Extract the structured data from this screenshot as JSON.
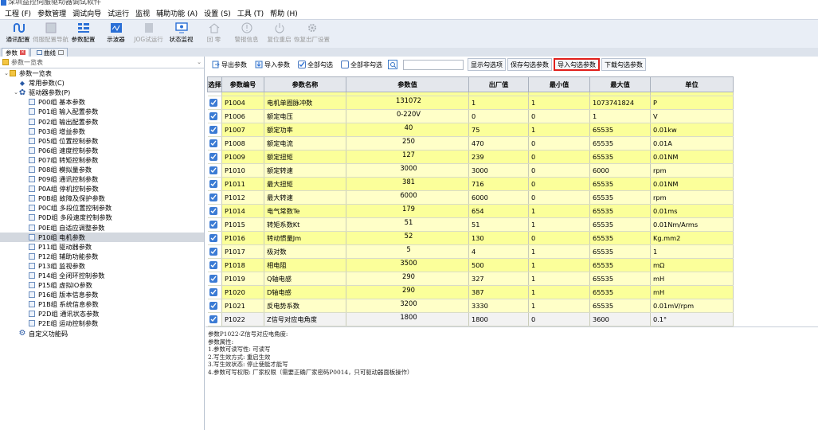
{
  "window": {
    "title": "深圳益控伺服驱动器调试软件"
  },
  "menu": [
    "工程 (F)",
    "参数管理",
    "调试向导",
    "试运行",
    "监视",
    "辅助功能 (A)",
    "设置 (S)",
    "工具 (T)",
    "帮助 (H)"
  ],
  "toolbar": [
    {
      "label": "通讯配置",
      "icon": "link-icon",
      "enabled": true
    },
    {
      "label": "伺服配置导航",
      "icon": "grid-icon",
      "enabled": false
    },
    {
      "label": "参数配置",
      "icon": "param-icon",
      "enabled": true
    },
    {
      "label": "示波器",
      "icon": "scope-icon",
      "enabled": true
    },
    {
      "label": "JOG试运行",
      "icon": "jog-icon",
      "enabled": false
    },
    {
      "label": "状态监视",
      "icon": "monitor-icon",
      "enabled": true
    },
    {
      "label": "回 零",
      "icon": "home-icon",
      "enabled": false
    },
    {
      "label": "警报信息",
      "icon": "alert-icon",
      "enabled": false
    },
    {
      "label": "复位重启",
      "icon": "power-icon",
      "enabled": false
    },
    {
      "label": "恢复出厂设置",
      "icon": "gear-icon",
      "enabled": false
    }
  ],
  "tabs": [
    {
      "label": "参数"
    },
    {
      "label": "曲线"
    }
  ],
  "left_panel": {
    "header": "参数一览表",
    "tree": [
      {
        "label": "参数一览表",
        "level": 0,
        "chev": "⌄",
        "icon": "folder-icon"
      },
      {
        "label": "常用参数(C)",
        "level": 1,
        "chev": "",
        "icon": "diamond-icon"
      },
      {
        "label": "驱动器参数(P)",
        "level": 1,
        "chev": "⌄",
        "icon": "gear-icon"
      },
      {
        "label": "P00组 基本参数",
        "level": 2,
        "chev": "",
        "icon": "doc-icon"
      },
      {
        "label": "P01组 输入配置参数",
        "level": 2,
        "chev": "",
        "icon": "doc-icon"
      },
      {
        "label": "P02组 输出配置参数",
        "level": 2,
        "chev": "",
        "icon": "doc-icon"
      },
      {
        "label": "P03组 增益参数",
        "level": 2,
        "chev": "",
        "icon": "doc-icon"
      },
      {
        "label": "P05组 位置控制参数",
        "level": 2,
        "chev": "",
        "icon": "doc-icon"
      },
      {
        "label": "P06组 速度控制参数",
        "level": 2,
        "chev": "",
        "icon": "doc-icon"
      },
      {
        "label": "P07组 转矩控制参数",
        "level": 2,
        "chev": "",
        "icon": "doc-icon"
      },
      {
        "label": "P08组 模拟量参数",
        "level": 2,
        "chev": "",
        "icon": "doc-icon"
      },
      {
        "label": "P09组 通讯控制参数",
        "level": 2,
        "chev": "",
        "icon": "doc-icon"
      },
      {
        "label": "P0A组 停机控制参数",
        "level": 2,
        "chev": "",
        "icon": "doc-icon"
      },
      {
        "label": "P0B组 故障及保护参数",
        "level": 2,
        "chev": "",
        "icon": "doc-icon"
      },
      {
        "label": "P0C组 多段位置控制参数",
        "level": 2,
        "chev": "",
        "icon": "doc-icon"
      },
      {
        "label": "P0D组 多段速度控制参数",
        "level": 2,
        "chev": "",
        "icon": "doc-icon"
      },
      {
        "label": "P0E组 自适应调整参数",
        "level": 2,
        "chev": "",
        "icon": "doc-icon"
      },
      {
        "label": "P10组 电机参数",
        "level": 2,
        "chev": "",
        "icon": "doc-icon",
        "selected": true
      },
      {
        "label": "P11组 驱动器参数",
        "level": 2,
        "chev": "",
        "icon": "doc-icon"
      },
      {
        "label": "P12组 辅助功能参数",
        "level": 2,
        "chev": "",
        "icon": "doc-icon"
      },
      {
        "label": "P13组 监视参数",
        "level": 2,
        "chev": "",
        "icon": "doc-icon"
      },
      {
        "label": "P14组 全闭环控制参数",
        "level": 2,
        "chev": "",
        "icon": "doc-icon"
      },
      {
        "label": "P15组 虚拟IO参数",
        "level": 2,
        "chev": "",
        "icon": "doc-icon"
      },
      {
        "label": "P16组 版本信息参数",
        "level": 2,
        "chev": "",
        "icon": "doc-icon"
      },
      {
        "label": "P1B组 系统信息参数",
        "level": 2,
        "chev": "",
        "icon": "doc-icon"
      },
      {
        "label": "P2D组 通讯状态参数",
        "level": 2,
        "chev": "",
        "icon": "doc-icon"
      },
      {
        "label": "P2E组 运动控制参数",
        "level": 2,
        "chev": "",
        "icon": "doc-icon"
      },
      {
        "label": "自定义功能码",
        "level": 1,
        "chev": "",
        "icon": "custom-icon"
      }
    ]
  },
  "param_toolbar": {
    "export": "导出参数",
    "import": "导入参数",
    "select_all": "全部勾选",
    "deselect_all": "全部非勾选",
    "search_value": "",
    "show_checked": "显示勾选项",
    "save_checked": "保存勾选参数",
    "import_checked": "导入勾选参数",
    "download_checked": "下载勾选参数"
  },
  "table": {
    "headers": [
      "选择",
      "参数编号",
      "参数名称",
      "参数值",
      "出厂值",
      "最小值",
      "最大值",
      "单位"
    ],
    "rows": [
      {
        "id": "P1004",
        "name": "电机单圈脉冲数",
        "value": "131072",
        "factory": "1",
        "min": "1",
        "max": "1073741824",
        "unit": "P"
      },
      {
        "id": "P1006",
        "name": "额定电压",
        "value": "0-220V",
        "factory": "0",
        "min": "0",
        "max": "1",
        "unit": "V"
      },
      {
        "id": "P1007",
        "name": "额定功率",
        "value": "40",
        "factory": "75",
        "min": "1",
        "max": "65535",
        "unit": "0.01kw"
      },
      {
        "id": "P1008",
        "name": "额定电流",
        "value": "250",
        "factory": "470",
        "min": "0",
        "max": "65535",
        "unit": "0.01A"
      },
      {
        "id": "P1009",
        "name": "额定扭矩",
        "value": "127",
        "factory": "239",
        "min": "0",
        "max": "65535",
        "unit": "0.01NM"
      },
      {
        "id": "P1010",
        "name": "额定转速",
        "value": "3000",
        "factory": "3000",
        "min": "0",
        "max": "6000",
        "unit": "rpm"
      },
      {
        "id": "P1011",
        "name": "最大扭矩",
        "value": "381",
        "factory": "716",
        "min": "0",
        "max": "65535",
        "unit": "0.01NM"
      },
      {
        "id": "P1012",
        "name": "最大转速",
        "value": "6000",
        "factory": "6000",
        "min": "0",
        "max": "65535",
        "unit": "rpm"
      },
      {
        "id": "P1014",
        "name": "电气常数Te",
        "value": "179",
        "factory": "654",
        "min": "1",
        "max": "65535",
        "unit": "0.01ms"
      },
      {
        "id": "P1015",
        "name": "转矩系数Kt",
        "value": "51",
        "factory": "51",
        "min": "1",
        "max": "65535",
        "unit": "0.01Nm/Arms"
      },
      {
        "id": "P1016",
        "name": "转动惯量Jm",
        "value": "52",
        "factory": "130",
        "min": "0",
        "max": "65535",
        "unit": "Kg.mm2"
      },
      {
        "id": "P1017",
        "name": "极对数",
        "value": "5",
        "factory": "4",
        "min": "1",
        "max": "65535",
        "unit": "1"
      },
      {
        "id": "P1018",
        "name": "相电阻",
        "value": "3500",
        "factory": "500",
        "min": "1",
        "max": "65535",
        "unit": "mΩ"
      },
      {
        "id": "P1019",
        "name": "Q轴电感",
        "value": "290",
        "factory": "327",
        "min": "1",
        "max": "65535",
        "unit": "mH"
      },
      {
        "id": "P1020",
        "name": "D轴电感",
        "value": "290",
        "factory": "387",
        "min": "1",
        "max": "65535",
        "unit": "mH"
      },
      {
        "id": "P1021",
        "name": "反电势系数",
        "value": "3200",
        "factory": "3330",
        "min": "1",
        "max": "65535",
        "unit": "0.01mV/rpm"
      },
      {
        "id": "P1022",
        "name": "Z信号对应电角度",
        "value": "1800",
        "factory": "1800",
        "min": "0",
        "max": "3600",
        "unit": "0.1°"
      }
    ]
  },
  "description": [
    "参数P1022-Z信号对应电角度:",
    "参数属性:",
    "1.参数可读写性: 可读写",
    "2.写生效方式: 重启生效",
    "3.写生效状态: 停止使能才能写",
    "4.参数可写权限: 厂家权限（需要正确厂家密码P0014，只可驱动器面板操作）"
  ],
  "colors": {
    "row_yellow": "#fbff9a",
    "highlight_border": "#e0201c",
    "check_blue": "#3b7bd4"
  }
}
